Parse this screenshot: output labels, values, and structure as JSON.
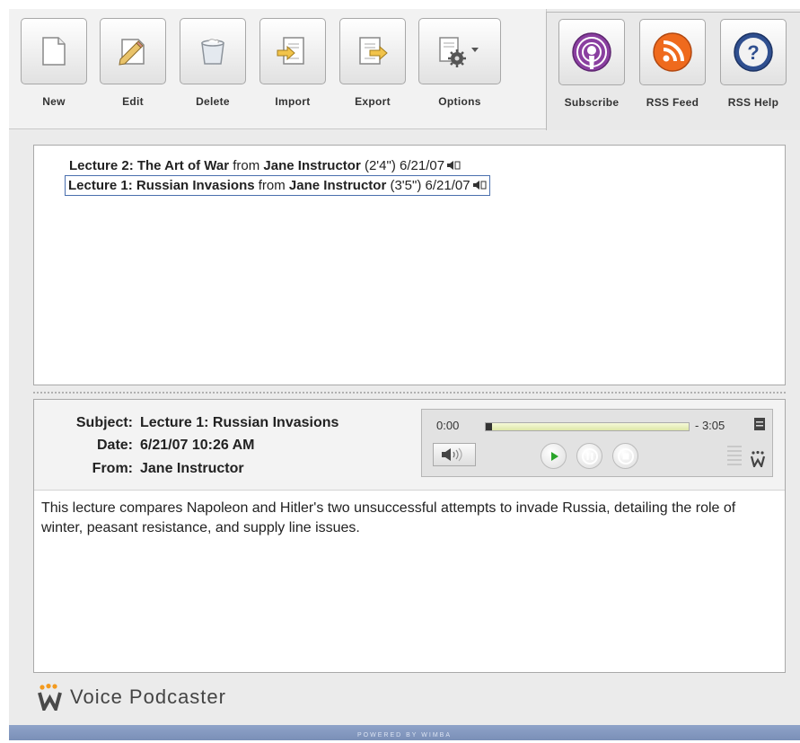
{
  "toolbar": {
    "new_label": "New",
    "edit_label": "Edit",
    "delete_label": "Delete",
    "import_label": "Import",
    "export_label": "Export",
    "options_label": "Options",
    "subscribe_label": "Subscribe",
    "rss_label": "RSS Feed",
    "help_label": "RSS Help"
  },
  "podcasts": [
    {
      "title": "Lecture 2: The Art of War",
      "from_word": "from",
      "author": "Jane Instructor",
      "duration": "(2'4\")",
      "date": "6/21/07",
      "selected": false
    },
    {
      "title": "Lecture 1: Russian Invasions",
      "from_word": "from",
      "author": "Jane Instructor",
      "duration": "(3'5\")",
      "date": "6/21/07",
      "selected": true
    }
  ],
  "detail": {
    "subject_label": "Subject:",
    "subject_value": "Lecture 1: Russian Invasions",
    "date_label": "Date:",
    "date_value": "6/21/07 10:26 AM",
    "from_label": "From:",
    "from_value": "Jane Instructor",
    "description": "This lecture compares Napoleon and Hitler's two unsuccessful attempts to invade Russia, detailing the role of winter, peasant resistance, and supply line issues."
  },
  "player": {
    "current_time": "0:00",
    "remaining_time": "- 3:05",
    "progress": 0.03
  },
  "footer": {
    "app_name": "Voice Podcaster",
    "powered_by": "POWERED BY WIMBA"
  },
  "colors": {
    "selection_border": "#4a6fae",
    "rss_orange": "#ef6a1d",
    "subscribe_purple": "#8a3fa0",
    "help_blue": "#2f4f8f",
    "footer_bar": "#7f93bb"
  }
}
